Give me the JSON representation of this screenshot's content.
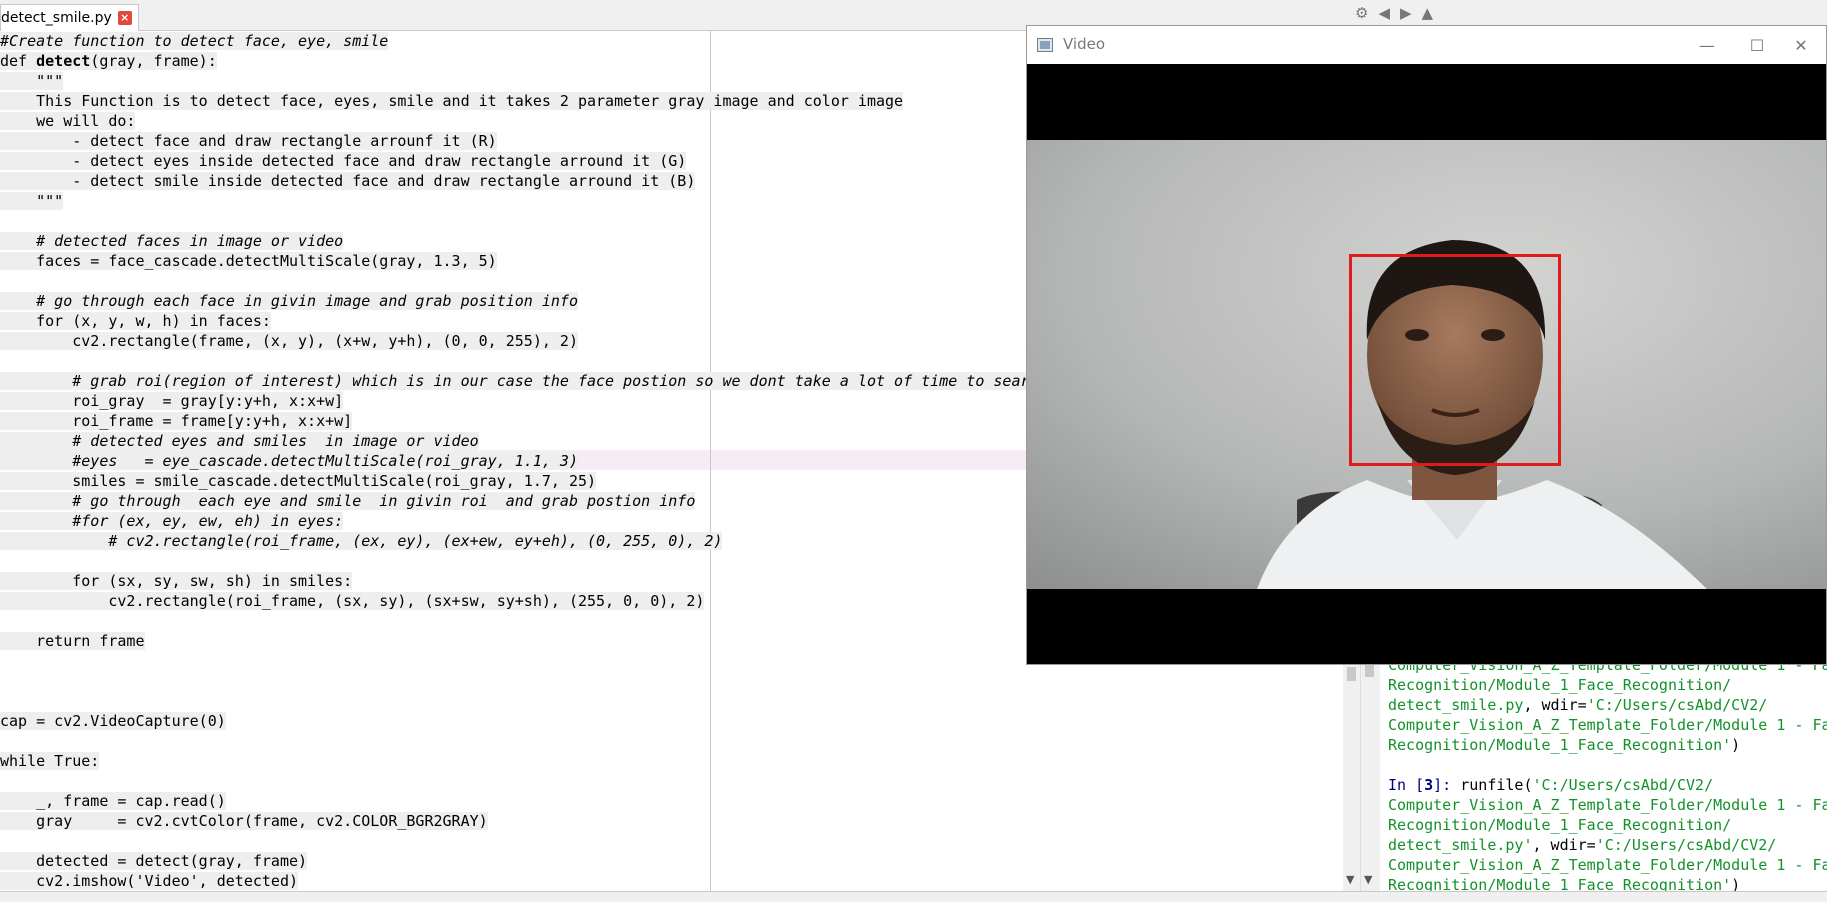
{
  "tab": {
    "filename": "detect_smile.py",
    "close": "×"
  },
  "toolbar": {
    "gear": "⚙",
    "back": "◀",
    "forward": "▶",
    "up": "▲"
  },
  "editor": {
    "lines": [
      {
        "text": "#Create function to detect face, eye, smile",
        "comment": true
      },
      {
        "text": "def detect(gray, frame):",
        "def": true
      },
      {
        "text": "    \"\"\""
      },
      {
        "text": "    This Function is to detect face, eyes, smile and it takes 2 parameter gray image and color image"
      },
      {
        "text": "    we will do:"
      },
      {
        "text": "        - detect face and draw rectangle arrounf it (R)"
      },
      {
        "text": "        - detect eyes inside detected face and draw rectangle arround it (G)"
      },
      {
        "text": "        - detect smile inside detected face and draw rectangle arround it (B)"
      },
      {
        "text": "    \"\"\""
      },
      {
        "text": ""
      },
      {
        "text": "    # detected faces in image or video",
        "comment": true
      },
      {
        "text": "    faces = face_cascade.detectMultiScale(gray, 1.3, 5)"
      },
      {
        "text": ""
      },
      {
        "text": "    # go through each face in givin image and grab position info",
        "comment": true
      },
      {
        "text": "    for (x, y, w, h) in faces:"
      },
      {
        "text": "        cv2.rectangle(frame, (x, y), (x+w, y+h), (0, 0, 255), 2)"
      },
      {
        "text": ""
      },
      {
        "text": "        # grab roi(region of interest) which is in our case the face postion so we dont take a lot of time to sear",
        "comment": true
      },
      {
        "text": "        roi_gray  = gray[y:y+h, x:x+w]"
      },
      {
        "text": "        roi_frame = frame[y:y+h, x:x+w]"
      },
      {
        "text": "        # detected eyes and smiles  in image or video",
        "comment": true
      },
      {
        "text": "        #eyes   = eye_cascade.detectMultiScale(roi_gray, 1.1, 3)",
        "comment": true
      },
      {
        "text": "        smiles = smile_cascade.detectMultiScale(roi_gray, 1.7, 25)"
      },
      {
        "text": "        # go through  each eye and smile  in givin roi  and grab postion info",
        "comment": true
      },
      {
        "text": "        #for (ex, ey, ew, eh) in eyes:",
        "comment": true
      },
      {
        "text": "            # cv2.rectangle(roi_frame, (ex, ey), (ex+ew, ey+eh), (0, 255, 0), 2)",
        "comment": true
      },
      {
        "text": ""
      },
      {
        "text": "        for (sx, sy, sw, sh) in smiles:"
      },
      {
        "text": "            cv2.rectangle(roi_frame, (sx, sy), (sx+sw, sy+sh), (255, 0, 0), 2)"
      },
      {
        "text": ""
      },
      {
        "text": "    return frame"
      },
      {
        "text": ""
      },
      {
        "text": ""
      },
      {
        "text": ""
      },
      {
        "text": "cap = cv2.VideoCapture(0)"
      },
      {
        "text": ""
      },
      {
        "text": "while True:"
      },
      {
        "text": ""
      },
      {
        "text": "    _, frame = cap.read()"
      },
      {
        "text": "    gray     = cv2.cvtColor(frame, cv2.COLOR_BGR2GRAY)"
      },
      {
        "text": ""
      },
      {
        "text": "    detected = detect(gray, frame)"
      },
      {
        "text": "    cv2.imshow('Video', detected)"
      }
    ]
  },
  "console": {
    "lines": [
      {
        "parts": [
          {
            "t": "Computer_Vision_A_Z_Template_Folder/Module 1 - Fa",
            "c": "g"
          }
        ]
      },
      {
        "parts": [
          {
            "t": "Recognition/Module_1_Face_Recognition/",
            "c": "g"
          }
        ]
      },
      {
        "parts": [
          {
            "t": "detect_smile.py",
            "c": "g"
          },
          {
            "t": ", wdir=",
            "c": "k"
          },
          {
            "t": "'C:/Users/csAbd/CV2/",
            "c": "g"
          }
        ]
      },
      {
        "parts": [
          {
            "t": "Computer_Vision_A_Z_Template_Folder/Module 1 - Fa",
            "c": "g"
          }
        ]
      },
      {
        "parts": [
          {
            "t": "Recognition/Module_1_Face_Recognition'",
            "c": "g"
          },
          {
            "t": ")",
            "c": "k"
          }
        ]
      },
      {
        "parts": []
      },
      {
        "parts": [
          {
            "t": "In [",
            "c": "p"
          },
          {
            "t": "3",
            "c": "pb"
          },
          {
            "t": "]: ",
            "c": "p"
          },
          {
            "t": "runfile(",
            "c": "k"
          },
          {
            "t": "'C:/Users/csAbd/CV2/",
            "c": "g"
          }
        ]
      },
      {
        "parts": [
          {
            "t": "Computer_Vision_A_Z_Template_Folder/Module 1 - Fa",
            "c": "g"
          }
        ]
      },
      {
        "parts": [
          {
            "t": "Recognition/Module_1_Face_Recognition/",
            "c": "g"
          }
        ]
      },
      {
        "parts": [
          {
            "t": "detect_smile.py'",
            "c": "g"
          },
          {
            "t": ", wdir=",
            "c": "k"
          },
          {
            "t": "'C:/Users/csAbd/CV2/",
            "c": "g"
          }
        ]
      },
      {
        "parts": [
          {
            "t": "Computer_Vision_A_Z_Template_Folder/Module 1 - Fa",
            "c": "g"
          }
        ]
      },
      {
        "parts": [
          {
            "t": "Recognition/Module_1_Face_Recognition'",
            "c": "g"
          },
          {
            "t": ")",
            "c": "k"
          }
        ]
      }
    ]
  },
  "video_window": {
    "title": "Video",
    "minimize": "—",
    "maximize": "☐",
    "close": "✕",
    "detection_box_color": "#e01b1b"
  },
  "colors": {
    "comment_bg": "#eeeeee",
    "console_green": "#13922a",
    "prompt_blue": "#00007f",
    "highlight_line": "#f7ecf6"
  }
}
